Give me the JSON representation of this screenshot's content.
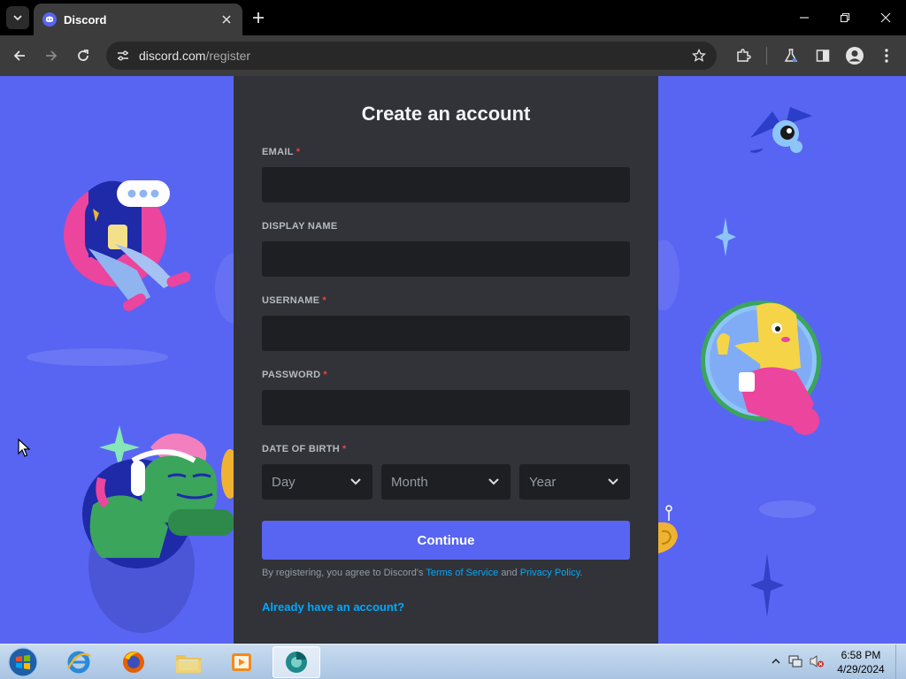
{
  "browser": {
    "tab_title": "Discord",
    "url_host": "discord.com",
    "url_path": "/register"
  },
  "form": {
    "title": "Create an account",
    "fields": [
      {
        "label": "EMAIL",
        "required": "*",
        "value": ""
      },
      {
        "label": "DISPLAY NAME",
        "required": "",
        "value": ""
      },
      {
        "label": "USERNAME",
        "required": "*",
        "value": ""
      },
      {
        "label": "PASSWORD",
        "required": "*",
        "value": ""
      }
    ],
    "dob": {
      "label": "DATE OF BIRTH",
      "required": "*",
      "day": "Day",
      "month": "Month",
      "year": "Year"
    },
    "continue_label": "Continue",
    "terms_prefix": "By registering, you agree to Discord's",
    "terms_link": "Terms of Service",
    "terms_and": "and",
    "privacy_link": "Privacy Policy",
    "terms_suffix": ".",
    "login_link": "Already have an account?"
  },
  "taskbar": {
    "time": "6:58 PM",
    "date": "4/29/2024"
  },
  "colors": {
    "brand": "#5865f2",
    "card": "#313338",
    "input": "#1e1f22",
    "link": "#00a8fc",
    "required": "#f23f43"
  }
}
